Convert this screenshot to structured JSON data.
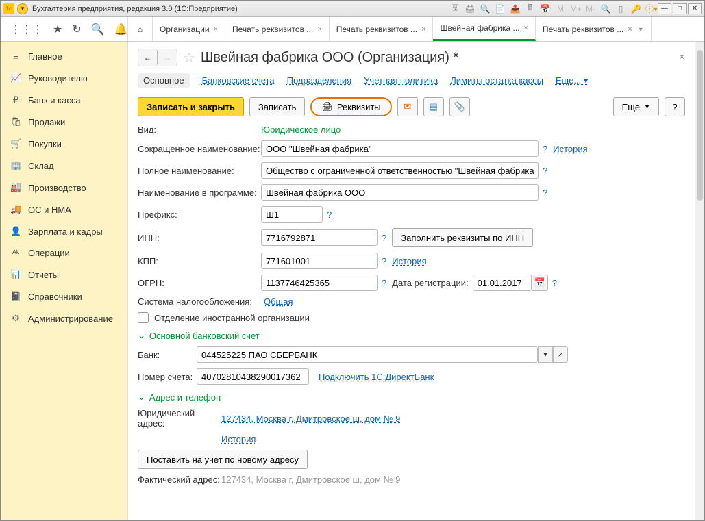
{
  "titlebar": {
    "text": "Бухгалтерия предприятия, редакция 3.0  (1С:Предприятие)"
  },
  "tabs": [
    {
      "label": "Организации",
      "close": true
    },
    {
      "label": "Печать реквизитов ...",
      "close": true
    },
    {
      "label": "Печать реквизитов ...",
      "close": true
    },
    {
      "label": "Швейная фабрика ...",
      "close": true,
      "active": true
    },
    {
      "label": "Печать реквизитов ...",
      "close": true,
      "dd": true
    }
  ],
  "sidebar": [
    {
      "icon": "≡",
      "label": "Главное"
    },
    {
      "icon": "📈",
      "label": "Руководителю"
    },
    {
      "icon": "₽",
      "label": "Банк и касса"
    },
    {
      "icon": "🛍",
      "label": "Продажи"
    },
    {
      "icon": "🛒",
      "label": "Покупки"
    },
    {
      "icon": "🏢",
      "label": "Склад"
    },
    {
      "icon": "🏭",
      "label": "Производство"
    },
    {
      "icon": "🚚",
      "label": "ОС и НМА"
    },
    {
      "icon": "👤",
      "label": "Зарплата и кадры"
    },
    {
      "icon": "ᴬᵏ",
      "label": "Операции"
    },
    {
      "icon": "📊",
      "label": "Отчеты"
    },
    {
      "icon": "📓",
      "label": "Справочники"
    },
    {
      "icon": "⚙",
      "label": "Администрирование"
    }
  ],
  "page": {
    "title": "Швейная фабрика ООО (Организация) *",
    "subnav": {
      "main": "Основное",
      "bank": "Банковские счета",
      "dept": "Подразделения",
      "policy": "Учетная политика",
      "limits": "Лимиты остатка кассы",
      "more": "Еще..."
    },
    "actions": {
      "save_close": "Записать и закрыть",
      "save": "Записать",
      "requisites": "Реквизиты",
      "more": "Еще"
    },
    "fields": {
      "kind_lbl": "Вид:",
      "kind_val": "Юридическое лицо",
      "short_lbl": "Сокращенное наименование:",
      "short_val": "ООО \"Швейная фабрика\"",
      "history": "История",
      "full_lbl": "Полное наименование:",
      "full_val": "Общество с ограниченной ответственностью \"Швейная фабрика\"",
      "prog_lbl": "Наименование в программе:",
      "prog_val": "Швейная фабрика ООО",
      "prefix_lbl": "Префикс:",
      "prefix_val": "Ш1",
      "inn_lbl": "ИНН:",
      "inn_val": "7716792871",
      "fill_inn": "Заполнить реквизиты по ИНН",
      "kpp_lbl": "КПП:",
      "kpp_val": "771601001",
      "ogrn_lbl": "ОГРН:",
      "ogrn_val": "1137746425365",
      "regdate_lbl": "Дата регистрации:",
      "regdate_val": "01.01.2017",
      "tax_lbl": "Система налогообложения:",
      "tax_val": "Общая",
      "foreign": "Отделение иностранной организации",
      "sec_bank": "Основной банковский счет",
      "bank_lbl": "Банк:",
      "bank_val": "044525225 ПАО СБЕРБАНК",
      "acc_lbl": "Номер счета:",
      "acc_val": "40702810438290017362",
      "direct": "Подключить 1С:ДиректБанк",
      "sec_addr": "Адрес и телефон",
      "legal_lbl": "Юридический адрес:",
      "legal_val": "127434, Москва г, Дмитровское ш, дом № 9",
      "reg_btn": "Поставить на учет по новому адресу",
      "fact_lbl": "Фактический адрес:",
      "fact_val": "127434, Москва г, Дмитровское ш, дом № 9"
    }
  }
}
